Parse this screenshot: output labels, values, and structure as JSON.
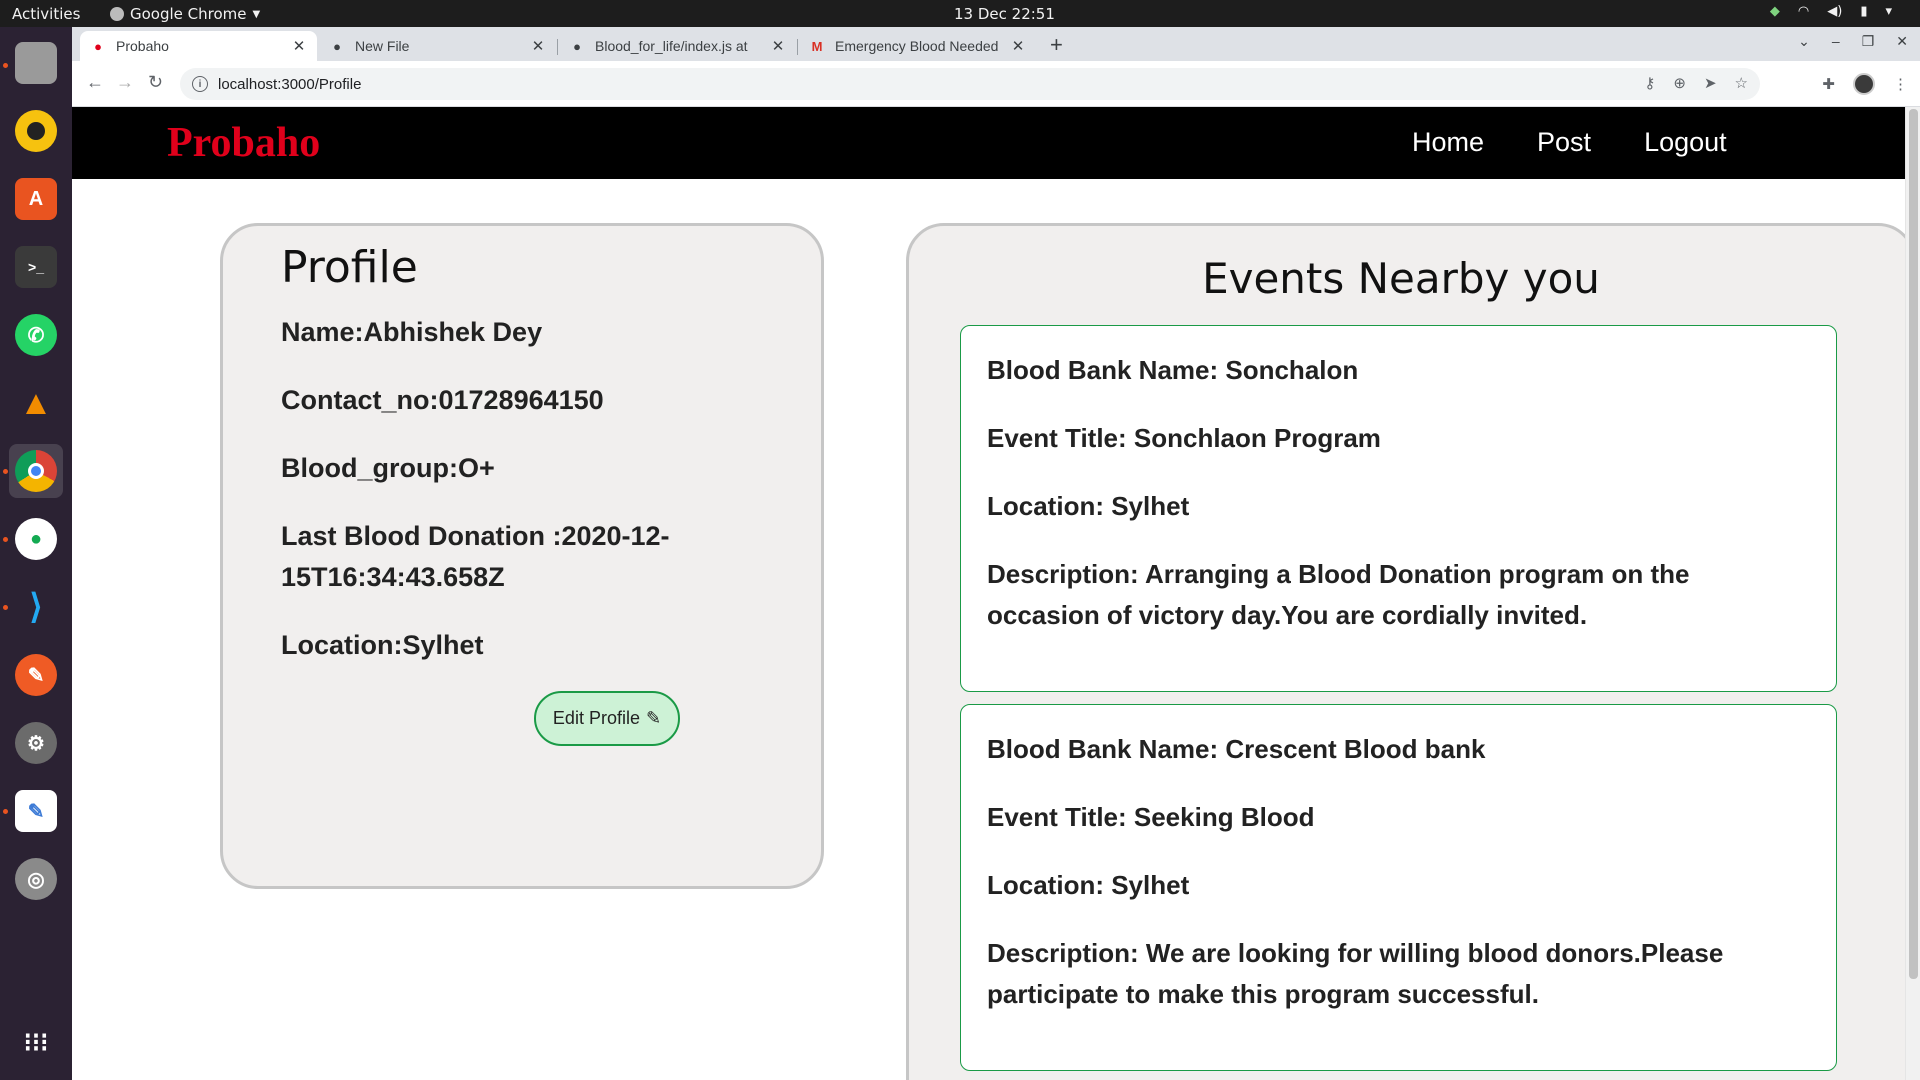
{
  "os": {
    "activities": "Activities",
    "app_menu": "Google Chrome",
    "clock": "13 Dec  22:51"
  },
  "browser": {
    "tabs": [
      {
        "title": "Probaho"
      },
      {
        "title": "New File"
      },
      {
        "title": "Blood_for_life/index.js at"
      },
      {
        "title": "Emergency Blood Needed"
      }
    ],
    "url": "localhost:3000/Profile"
  },
  "navbar": {
    "brand": "Probaho",
    "links": [
      "Home",
      "Post",
      "Logout"
    ]
  },
  "profile": {
    "title": "Profile",
    "name": "Name:Abhishek Dey",
    "contact": "Contact_no:01728964150",
    "blood_group": "Blood_group:O+",
    "last_donation": "Last Blood Donation :2020-12-15T16:34:43.658Z",
    "location": "Location:Sylhet",
    "edit_label": "Edit Profile"
  },
  "events": {
    "title": "Events Nearby you",
    "items": [
      {
        "bank": "Blood Bank Name: Sonchalon",
        "title": "Event Title: Sonchlaon Program",
        "location": "Location: Sylhet",
        "description": "Description: Arranging a Blood Donation program on the occasion of victory day.You are cordially invited."
      },
      {
        "bank": "Blood Bank Name: Crescent Blood bank",
        "title": "Event Title: Seeking Blood",
        "location": "Location: Sylhet",
        "description": "Description: We are looking for willing blood donors.Please participate to make this program successful."
      }
    ]
  }
}
